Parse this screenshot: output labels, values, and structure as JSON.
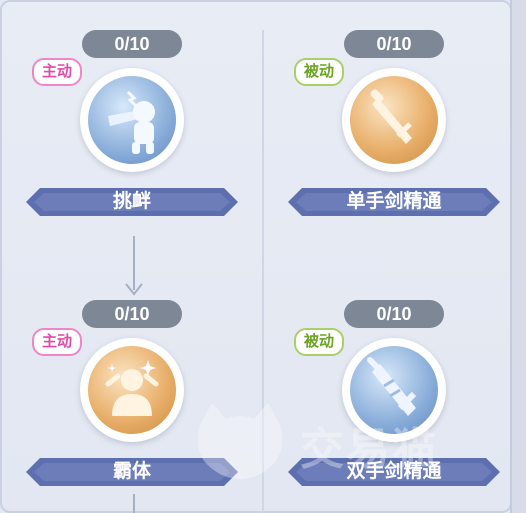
{
  "skills": [
    {
      "id": "taunt",
      "level": "0/10",
      "type": "主动",
      "name": "挑衅",
      "icon": "taunt-figure-icon",
      "tone": "blue"
    },
    {
      "id": "one-hand",
      "level": "0/10",
      "type": "被动",
      "name": "单手剑精通",
      "icon": "one-hand-sword-icon",
      "tone": "gold"
    },
    {
      "id": "super-armor",
      "level": "0/10",
      "type": "主动",
      "name": "霸体",
      "icon": "super-armor-figure-icon",
      "tone": "gold"
    },
    {
      "id": "two-hand",
      "level": "0/10",
      "type": "被动",
      "name": "双手剑精通",
      "icon": "two-hand-sword-icon",
      "tone": "blue"
    }
  ],
  "watermark": {
    "text": "交易猫"
  },
  "colors": {
    "active_badge": "#e14aa7",
    "passive_badge": "#6aa423",
    "banner": "#5d6fae"
  }
}
